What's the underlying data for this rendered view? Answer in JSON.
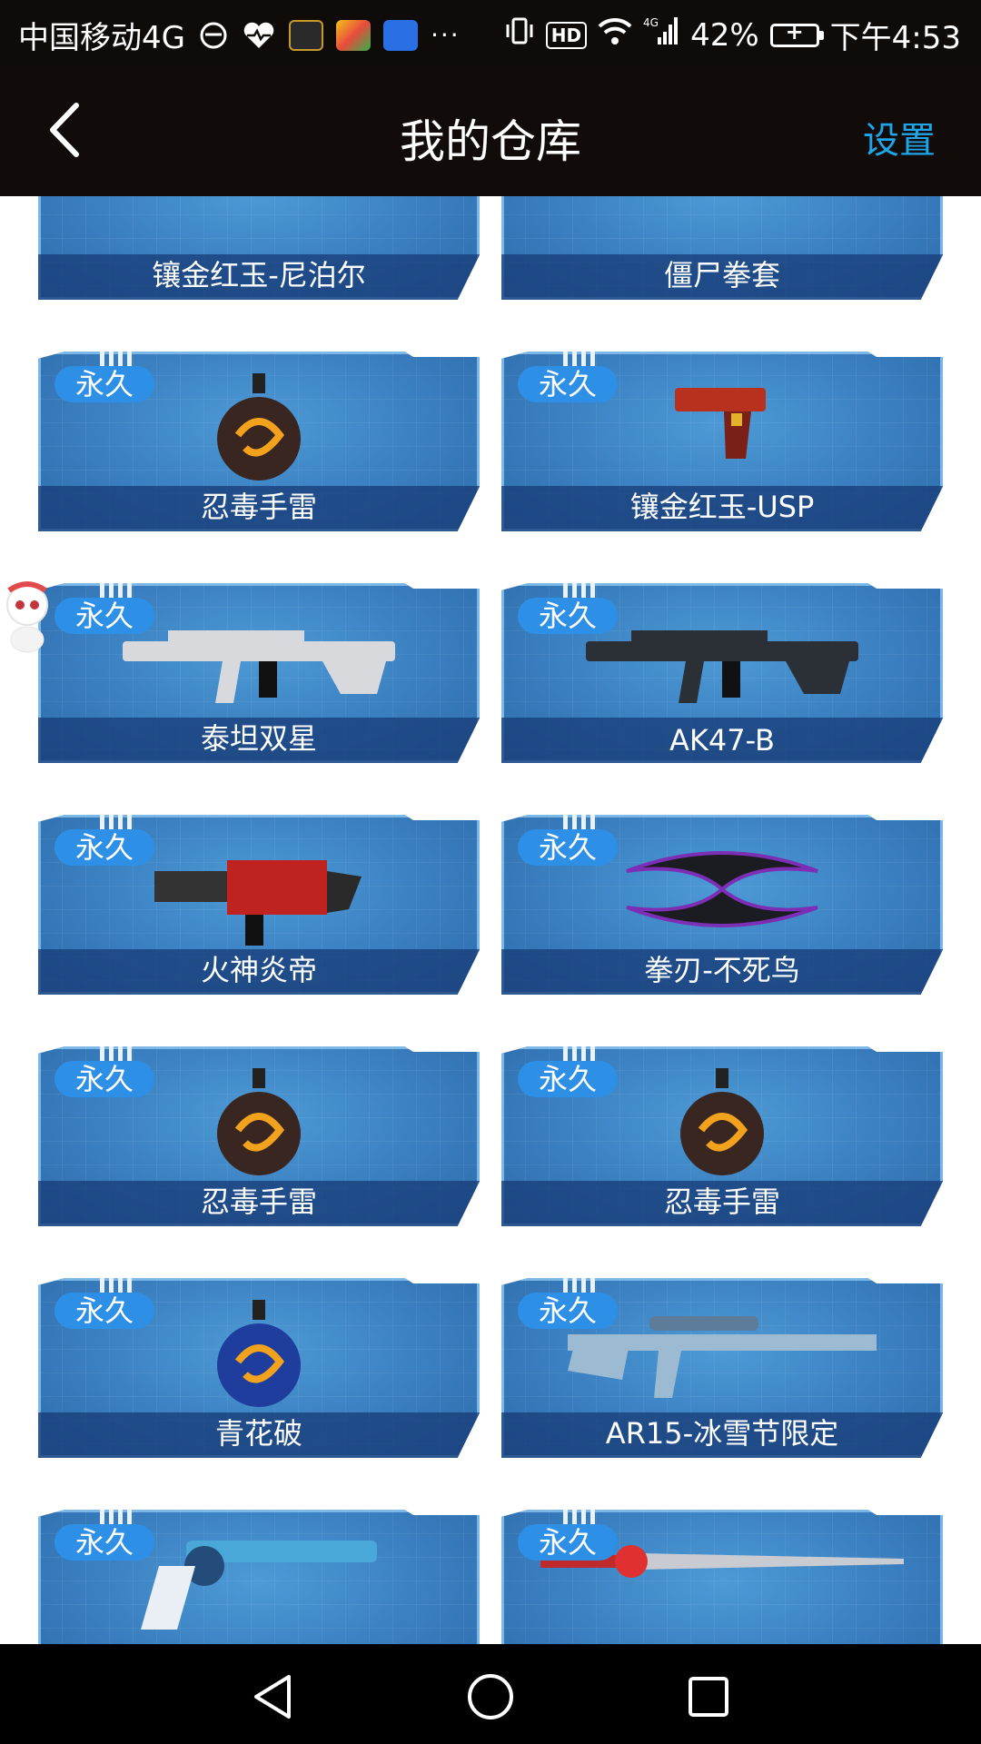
{
  "status_bar": {
    "carrier": "中国移动4G",
    "battery_percent": "42%",
    "time": "下午4:53",
    "network": "4G",
    "hd_label": "HD",
    "more": "···"
  },
  "header": {
    "title": "我的仓库",
    "settings_label": "设置"
  },
  "items": [
    {
      "name": "镶金红玉-尼泊尔",
      "badge": "",
      "icon": "knife-icon",
      "color": "#b3262a"
    },
    {
      "name": "僵尸拳套",
      "badge": "",
      "icon": "claw-icon",
      "color": "#2eaa3c"
    },
    {
      "name": "忍毒手雷",
      "badge": "永久",
      "icon": "grenade-icon",
      "color": "#3a2620"
    },
    {
      "name": "镶金红玉-USP",
      "badge": "永久",
      "icon": "pistol-icon",
      "color": "#b8301e"
    },
    {
      "name": "泰坦双星",
      "badge": "永久",
      "icon": "rifle-icon",
      "color": "#d7d9dc"
    },
    {
      "name": "AK47-B",
      "badge": "永久",
      "icon": "rifle-icon",
      "color": "#2b2f36"
    },
    {
      "name": "火神炎帝",
      "badge": "永久",
      "icon": "gatling-icon",
      "color": "#c0221f"
    },
    {
      "name": "拳刃-不死鸟",
      "badge": "永久",
      "icon": "blade-icon",
      "color": "#7c2fb4"
    },
    {
      "name": "忍毒手雷",
      "badge": "永久",
      "icon": "grenade-icon",
      "color": "#3a2620"
    },
    {
      "name": "忍毒手雷",
      "badge": "永久",
      "icon": "grenade-icon",
      "color": "#3a2620"
    },
    {
      "name": "青花破",
      "badge": "永久",
      "icon": "grenade-icon",
      "color": "#1f3d9c"
    },
    {
      "name": "AR15-冰雪节限定",
      "badge": "永久",
      "icon": "sniper-icon",
      "color": "#9cbad2"
    },
    {
      "name": "",
      "badge": "永久",
      "icon": "revolver-icon",
      "color": "#4aa8d8"
    },
    {
      "name": "",
      "badge": "永久",
      "icon": "sword-icon",
      "color": "#c8ccd2"
    }
  ]
}
